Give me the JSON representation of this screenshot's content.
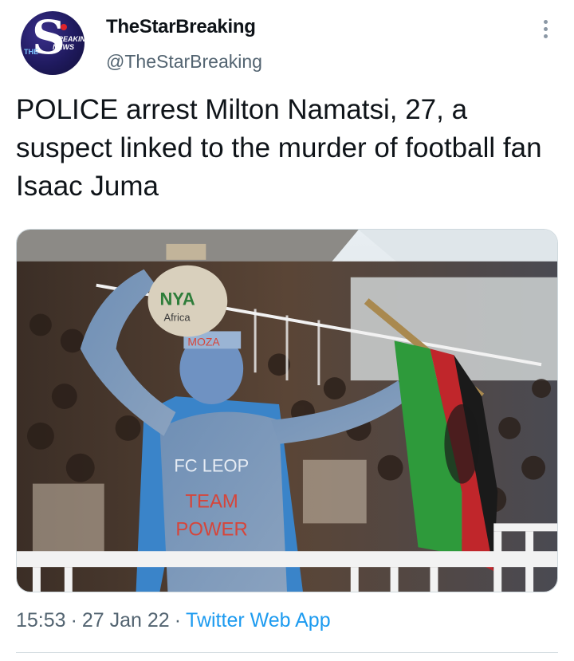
{
  "author": {
    "display_name": "TheStarBreaking",
    "handle": "@TheStarBreaking",
    "avatar": {
      "letter": "S",
      "tag": "THE",
      "caption_line1": "BREAKING",
      "caption_line2": "NEWS"
    }
  },
  "tweet": {
    "text": "POLICE arrest Milton Namatsi, 27, a suspect linked to the murder of football fan Isaac Juma"
  },
  "media": {
    "gourd_text": "NYA",
    "gourd_text2": "Africa",
    "body_text1": "FC LEOP",
    "body_text2": "TEAM",
    "body_text3": "POWER",
    "head_text": "MOZA"
  },
  "meta": {
    "time": "15:53",
    "date": "27 Jan 22",
    "separator": "·",
    "source": "Twitter Web App"
  },
  "colors": {
    "source_link": "#1d9bf0",
    "secondary_text": "#536471",
    "primary_text": "#0f1419"
  }
}
